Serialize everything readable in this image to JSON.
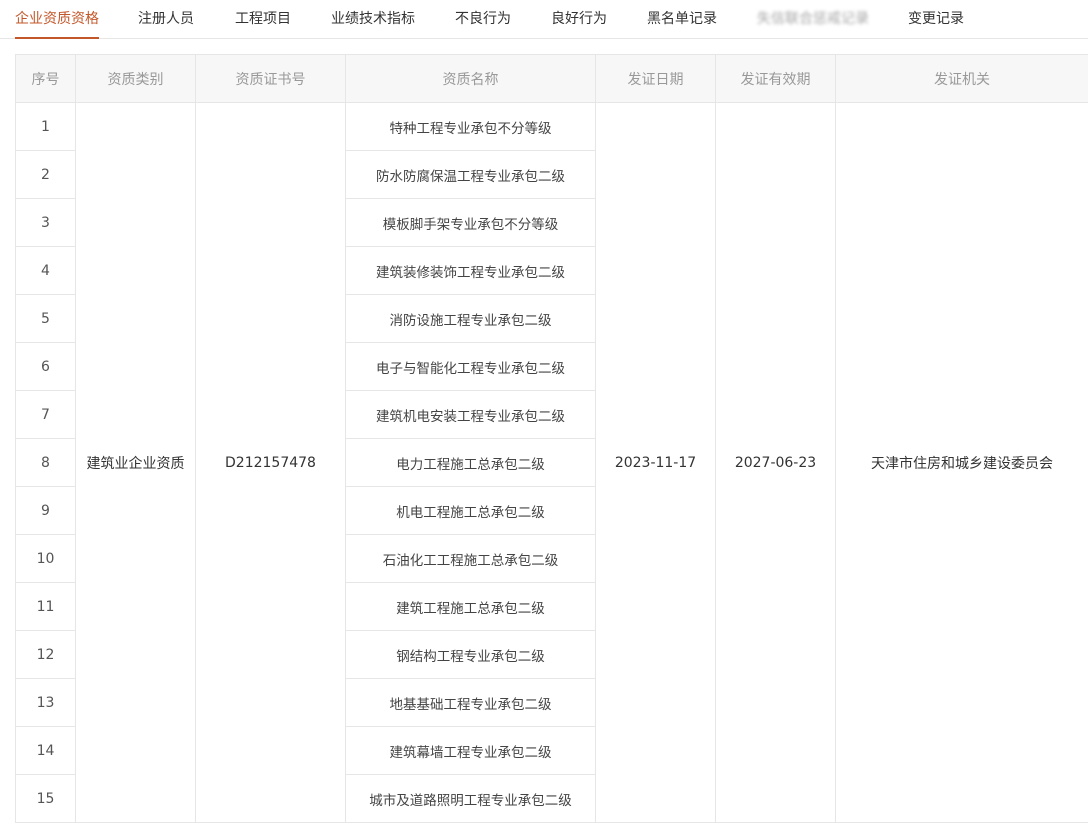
{
  "tabs": [
    {
      "label": "企业资质资格",
      "active": true
    },
    {
      "label": "注册人员",
      "active": false
    },
    {
      "label": "工程项目",
      "active": false
    },
    {
      "label": "业绩技术指标",
      "active": false
    },
    {
      "label": "不良行为",
      "active": false
    },
    {
      "label": "良好行为",
      "active": false
    },
    {
      "label": "黑名单记录",
      "active": false
    },
    {
      "label": "失信联合惩戒记录",
      "active": false,
      "blurred": true
    },
    {
      "label": "变更记录",
      "active": false
    }
  ],
  "colors": {
    "accent": "#c4572a",
    "border": "#e6e6e6",
    "header_bg": "#f7f7f7"
  },
  "table": {
    "headers": [
      "序号",
      "资质类别",
      "资质证书号",
      "资质名称",
      "发证日期",
      "发证有效期",
      "发证机关"
    ],
    "merged": {
      "category": "建筑业企业资质",
      "cert_no": "D212157478",
      "issue_date": "2023-11-17",
      "valid_until": "2027-06-23",
      "authority": "天津市住房和城乡建设委员会"
    },
    "rows": [
      {
        "seq": "1",
        "name": "特种工程专业承包不分等级"
      },
      {
        "seq": "2",
        "name": "防水防腐保温工程专业承包二级"
      },
      {
        "seq": "3",
        "name": "模板脚手架专业承包不分等级"
      },
      {
        "seq": "4",
        "name": "建筑装修装饰工程专业承包二级"
      },
      {
        "seq": "5",
        "name": "消防设施工程专业承包二级"
      },
      {
        "seq": "6",
        "name": "电子与智能化工程专业承包二级"
      },
      {
        "seq": "7",
        "name": "建筑机电安装工程专业承包二级"
      },
      {
        "seq": "8",
        "name": "电力工程施工总承包二级"
      },
      {
        "seq": "9",
        "name": "机电工程施工总承包二级"
      },
      {
        "seq": "10",
        "name": "石油化工工程施工总承包二级"
      },
      {
        "seq": "11",
        "name": "建筑工程施工总承包二级"
      },
      {
        "seq": "12",
        "name": "钢结构工程专业承包二级"
      },
      {
        "seq": "13",
        "name": "地基基础工程专业承包二级"
      },
      {
        "seq": "14",
        "name": "建筑幕墙工程专业承包二级"
      },
      {
        "seq": "15",
        "name": "城市及道路照明工程专业承包二级"
      }
    ]
  }
}
